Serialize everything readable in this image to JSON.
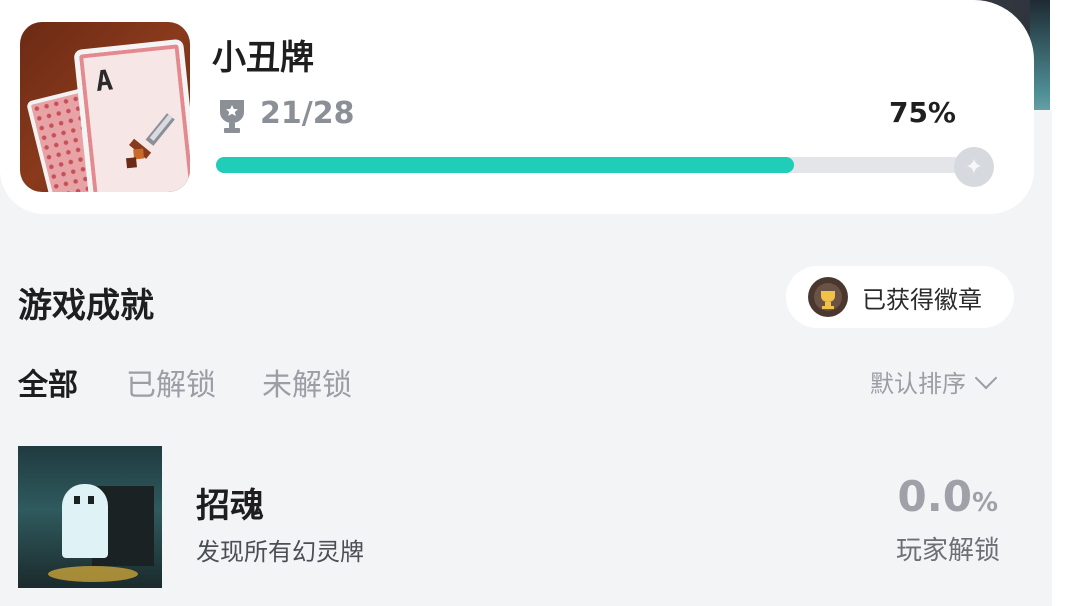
{
  "game": {
    "title": "小丑牌",
    "icon_card_letter": "A",
    "progress_text": "21/28",
    "progress_percent_label": "75%",
    "progress_fraction": 0.75
  },
  "section": {
    "title": "游戏成就",
    "badge_button_label": "已获得徽章"
  },
  "tabs": [
    {
      "label": "全部",
      "active": true
    },
    {
      "label": "已解锁",
      "active": false
    },
    {
      "label": "未解锁",
      "active": false
    }
  ],
  "sort": {
    "label": "默认排序"
  },
  "achievements": [
    {
      "title": "招魂",
      "description": "发现所有幻灵牌",
      "rate_value": "0.0",
      "rate_unit": "%",
      "rate_label": "玩家解锁"
    }
  ],
  "colors": {
    "accent": "#20cdb9",
    "track": "#e3e5e8",
    "muted_text": "#9a9ea5"
  },
  "icons": [
    "trophy-icon",
    "star-icon",
    "badge-icon",
    "chevron-down-icon"
  ]
}
